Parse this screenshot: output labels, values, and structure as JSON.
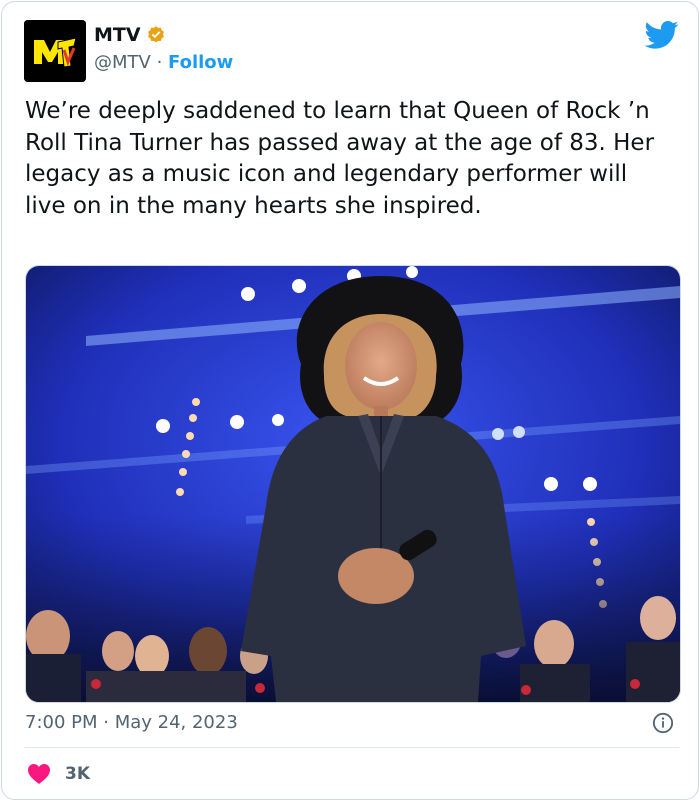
{
  "account": {
    "name": "MTV",
    "handle": "@MTV",
    "separator": " · ",
    "follow_label": "Follow",
    "verified_color": "#e8a317",
    "logo_text": "MTV"
  },
  "tweet": {
    "text": "We’re deeply saddened to learn that Queen of Rock ’n Roll Tina Turner has passed away at the age of 83. Her legacy as a music icon and legendary performer will live on in the many hearts she inspired.",
    "timestamp": "7:00 PM · May 24, 2023",
    "like_count": "3K"
  },
  "colors": {
    "twitter_blue": "#1d9bf0",
    "heart": "#f91880",
    "logo_yellow": "#ffe600",
    "stage_blue": "#2b3fd6"
  },
  "icons": {
    "brand": "twitter-bird-icon",
    "verified": "verified-badge-icon",
    "info": "info-icon",
    "like": "heart-icon"
  }
}
